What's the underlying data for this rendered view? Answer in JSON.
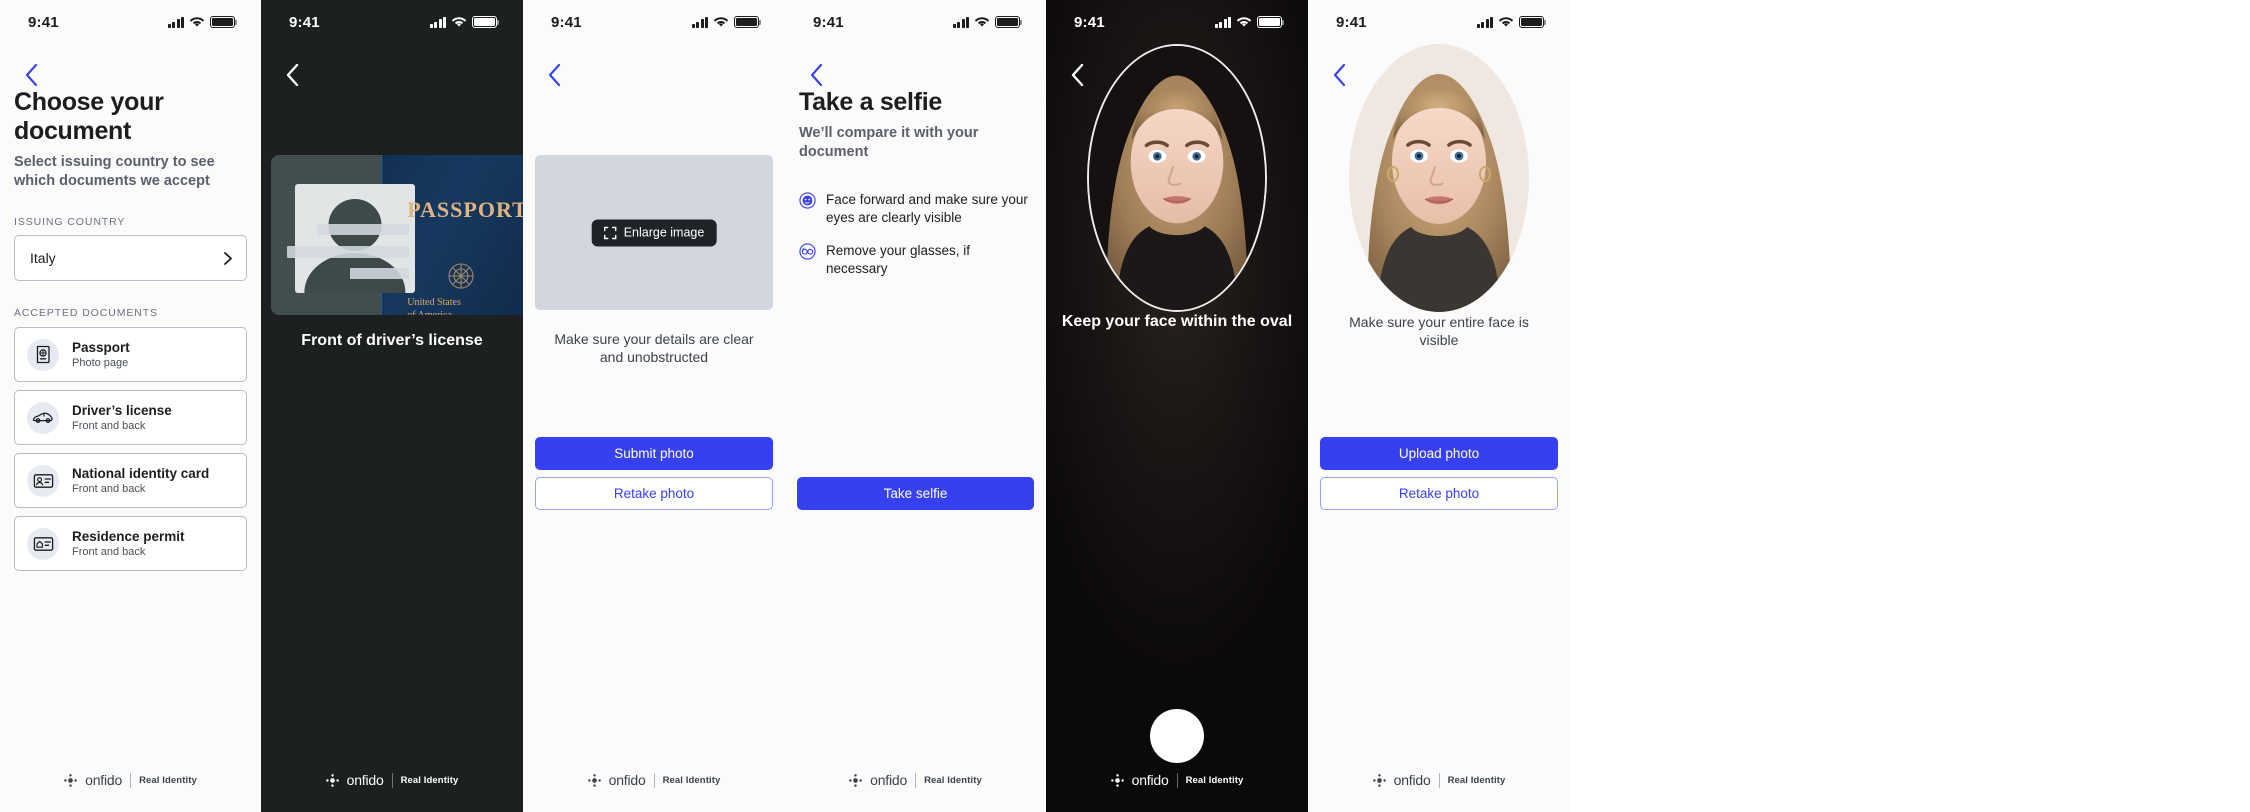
{
  "statusbar": {
    "time": "9:41"
  },
  "brand": {
    "accent": "#3640f0",
    "word": "onfido",
    "tag": "Real Identity"
  },
  "panels": [
    {
      "id": "choose-document",
      "theme": "light",
      "title": "Choose your document",
      "subtitle": "Select issuing country to see which documents we accept",
      "issuing_country_label": "ISSUING COUNTRY",
      "issuing_country_value": "Italy",
      "accepted_label": "ACCEPTED DOCUMENTS",
      "documents": [
        {
          "title": "Passport",
          "sub": "Photo page",
          "icon": "passport-icon"
        },
        {
          "title": "Driver’s license",
          "sub": "Front and back",
          "icon": "car-icon"
        },
        {
          "title": "National identity card",
          "sub": "Front and back",
          "icon": "id-card-icon"
        },
        {
          "title": "Residence permit",
          "sub": "Front and back",
          "icon": "residence-permit-icon"
        }
      ]
    },
    {
      "id": "document-capture",
      "theme": "dark",
      "caption": "Front of driver’s license",
      "passport_text": "PASSPORT",
      "passport_country_line1": "United States",
      "passport_country_line2": "of America"
    },
    {
      "id": "submit-photo",
      "theme": "light",
      "tooltip": "Enlarge image",
      "caption": "Make sure your details are clear and unobstructed",
      "primary_button": "Submit photo",
      "secondary_button": "Retake photo"
    },
    {
      "id": "take-a-selfie",
      "theme": "light",
      "title": "Take a selfie",
      "subtitle": "We’ll compare it with your document",
      "bullets": [
        {
          "text": "Face forward and make sure your eyes are clearly visible",
          "icon": "face-forward-icon"
        },
        {
          "text": "Remove your glasses, if necessary",
          "icon": "glasses-icon"
        }
      ],
      "primary_button": "Take selfie"
    },
    {
      "id": "selfie-camera",
      "theme": "dark",
      "caption": "Keep your face within the oval",
      "shutter": "shutter-button"
    },
    {
      "id": "selfie-confirm",
      "theme": "light",
      "caption": "Make sure your entire face is visible",
      "primary_button": "Upload photo",
      "secondary_button": "Retake photo"
    }
  ]
}
